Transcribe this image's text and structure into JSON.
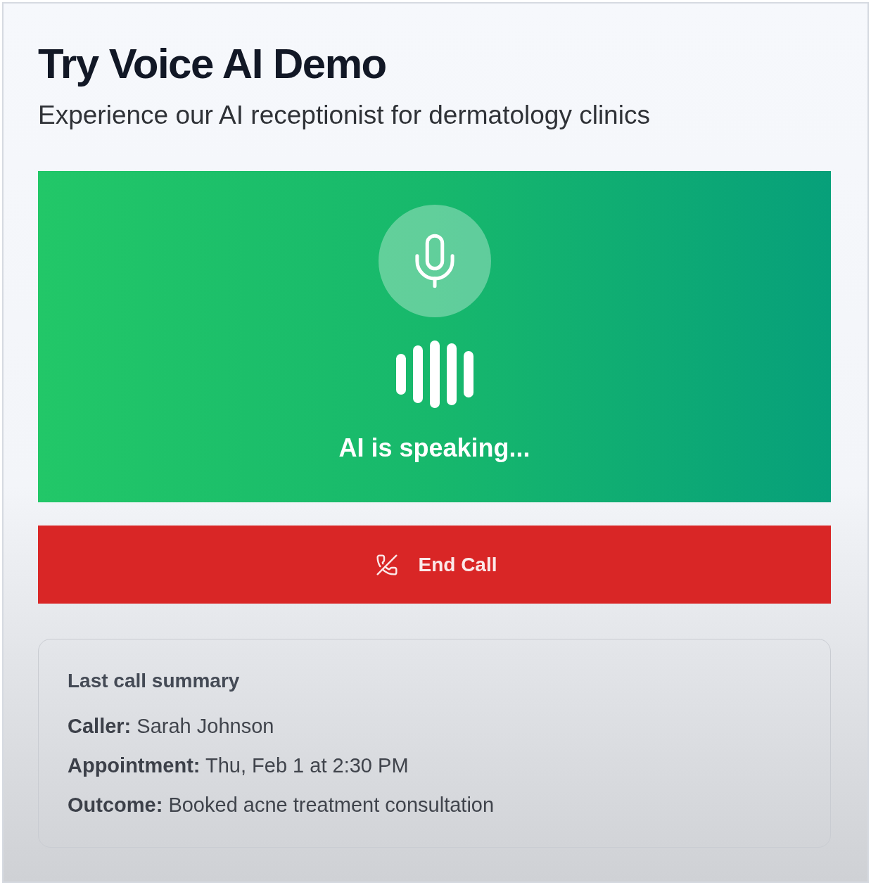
{
  "title": "Try Voice AI Demo",
  "subtitle": "Experience our AI receptionist for dermatology clinics",
  "voice_panel": {
    "status": "AI is speaking..."
  },
  "end_call_button": {
    "label": "End Call"
  },
  "summary": {
    "title": "Last call summary",
    "rows": [
      "**Caller:** Sarah Johnson",
      "**Appointment:** Thu, Feb 1 at 2:30 PM",
      "**Outcome:** Booked acne treatment consultation"
    ]
  }
}
